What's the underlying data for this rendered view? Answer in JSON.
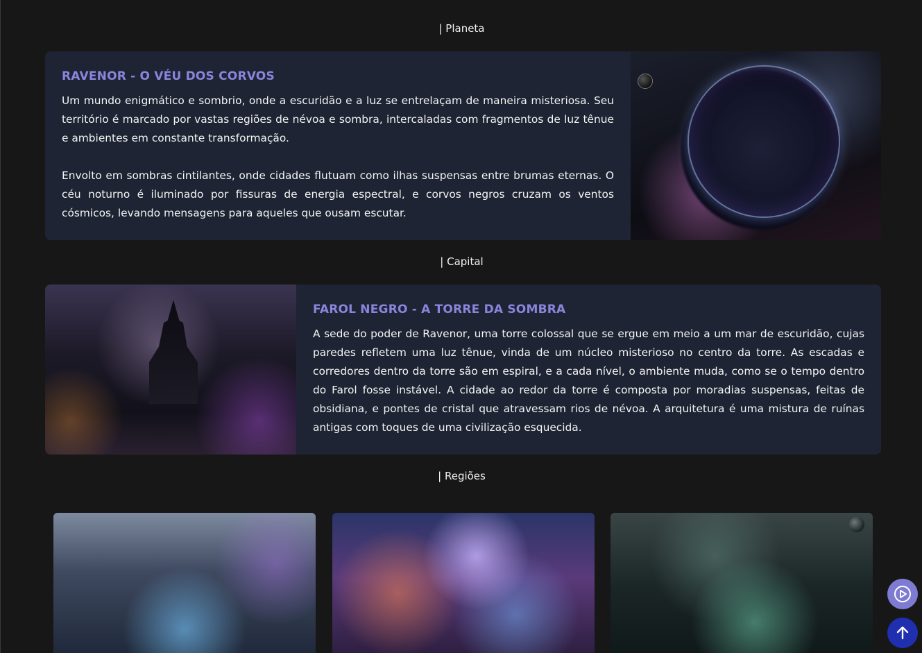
{
  "sections": {
    "planet_heading": "| Planeta",
    "capital_heading": "| Capital",
    "regions_heading": "| Regiões"
  },
  "planet": {
    "title": "RAVENOR - O VÉU DOS CORVOS",
    "paragraphs": [
      "Um mundo enigmático e sombrio, onde a escuridão e a luz se entrelaçam de maneira misteriosa. Seu território é marcado por vastas regiões de névoa e sombra, intercaladas com fragmentos de luz tênue e ambientes em constante transformação.",
      "Envolto em sombras cintilantes, onde cidades flutuam como ilhas suspensas entre brumas eternas. O céu noturno é iluminado por fissuras de energia espectral, e corvos negros cruzam os ventos cósmicos, levando mensagens para aqueles que ousam escutar."
    ]
  },
  "capital": {
    "title": "FAROL NEGRO - A TORRE DA SOMBRA",
    "paragraphs": [
      "A sede do poder de Ravenor, uma torre colossal que se ergue em meio a um mar de escuridão, cujas paredes refletem uma luz tênue, vinda de um núcleo misterioso no centro da torre. As escadas e corredores dentro da torre são em espiral, e a cada nível, o ambiente muda, como se o tempo dentro do Farol fosse instável. A cidade ao redor da torre é composta por moradias suspensas, feitas de obsidiana, e pontes de cristal que atravessam rios de névoa. A arquitetura é uma mistura de ruínas antigas com toques de uma civilização esquecida."
    ]
  },
  "colors": {
    "background": "#171717",
    "card": "#1e2433",
    "accent_title": "#8a85dc",
    "play_button": "#7e7bd3",
    "scroll_top_button": "#1f2fb0"
  },
  "icons": {
    "play": "play-circle-icon",
    "scroll_top": "arrow-up-icon"
  }
}
